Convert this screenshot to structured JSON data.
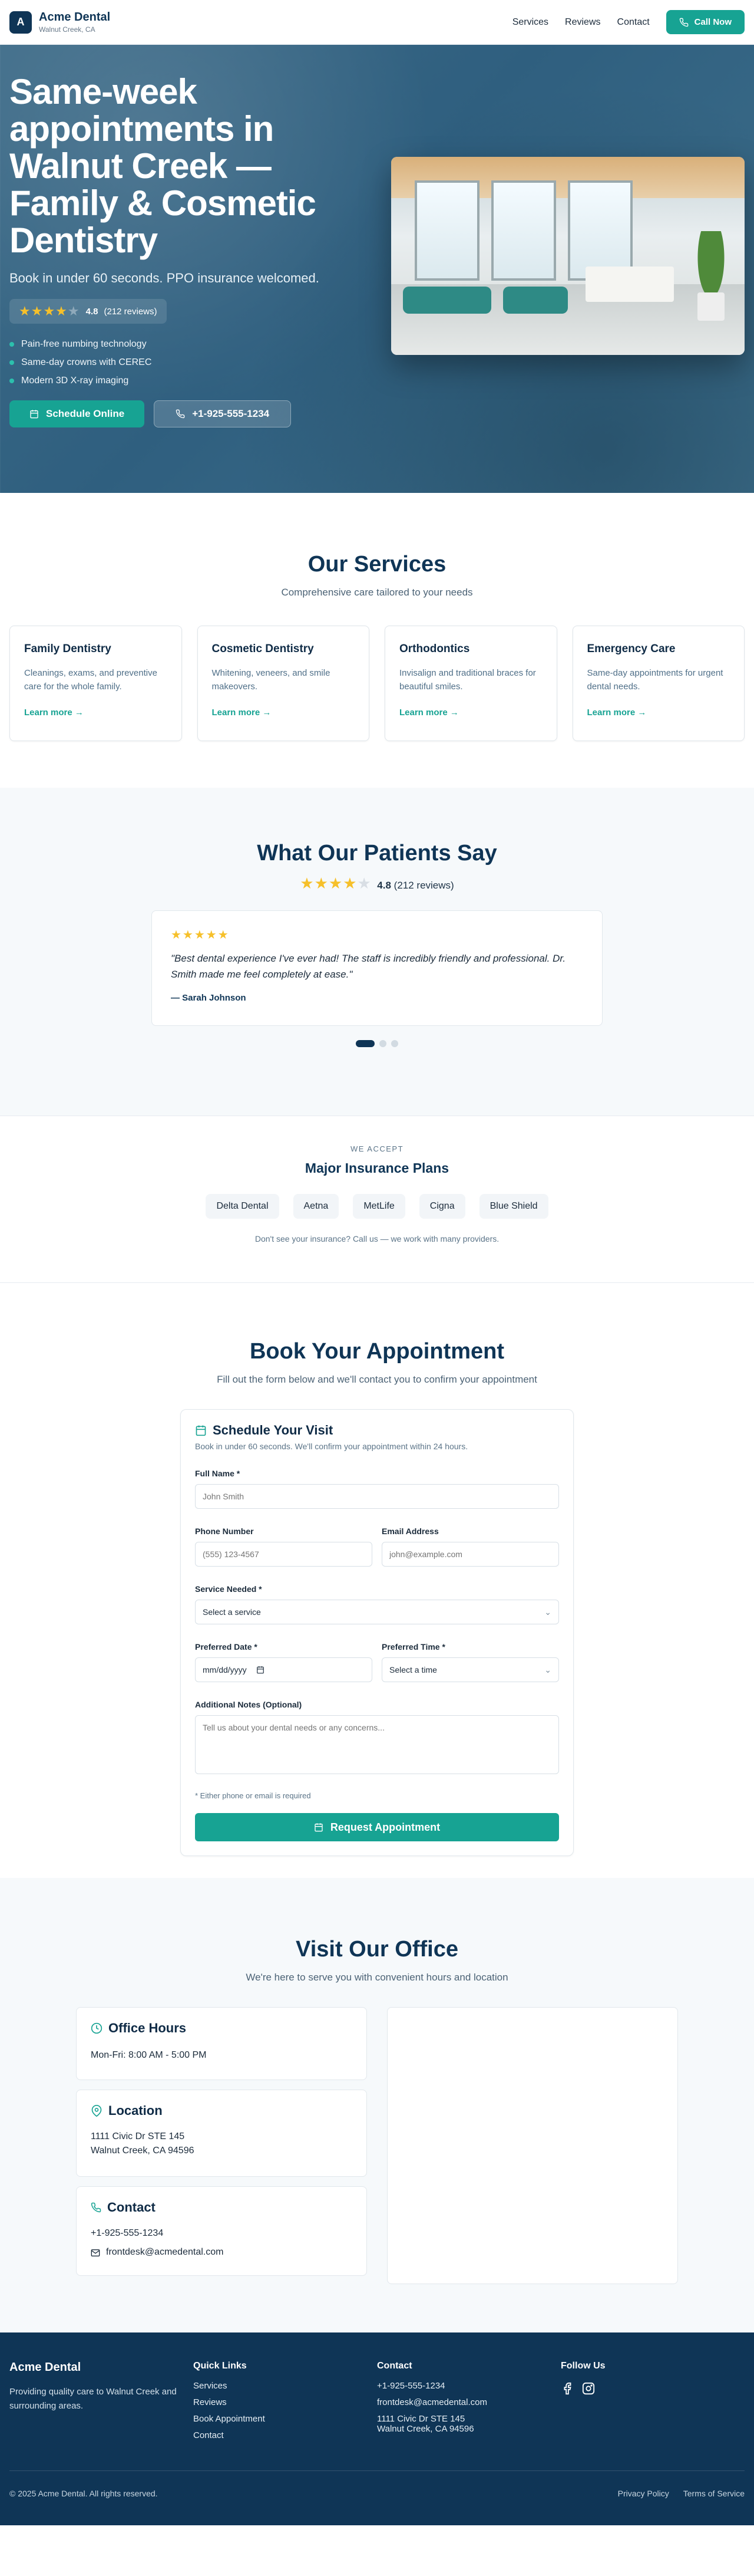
{
  "brand": {
    "logo_letter": "A",
    "name": "Acme Dental",
    "location": "Walnut Creek, CA"
  },
  "nav": {
    "links": [
      "Services",
      "Reviews",
      "Contact"
    ],
    "call_label": "Call Now"
  },
  "hero": {
    "title": "Same-week appointments in Walnut Creek — Family & Cosmetic Dentistry",
    "subtitle": "Book in under 60 seconds. PPO insurance welcomed.",
    "rating_value": "4.8",
    "rating_count": "(212 reviews)",
    "features": [
      "Pain-free numbing technology",
      "Same-day crowns with CEREC",
      "Modern 3D X-ray imaging"
    ],
    "primary_cta": "Schedule Online",
    "phone_cta": "+1-925-555-1234"
  },
  "services": {
    "title": "Our Services",
    "subtitle": "Comprehensive care tailored to your needs",
    "items": [
      {
        "title": "Family Dentistry",
        "desc": "Cleanings, exams, and preventive care for the whole family.",
        "link": "Learn more →"
      },
      {
        "title": "Cosmetic Dentistry",
        "desc": "Whitening, veneers, and smile makeovers.",
        "link": "Learn more →"
      },
      {
        "title": "Orthodontics",
        "desc": "Invisalign and traditional braces for beautiful smiles.",
        "link": "Learn more →"
      },
      {
        "title": "Emergency Care",
        "desc": "Same-day appointments for urgent dental needs.",
        "link": "Learn more →"
      }
    ]
  },
  "reviews": {
    "title": "What Our Patients Say",
    "rating_value": "4.8",
    "rating_count": "(212 reviews)",
    "quote": "\"Best dental experience I've ever had! The staff is incredibly friendly and professional. Dr. Smith made me feel completely at ease.\"",
    "author": "— Sarah Johnson",
    "active_slide": 1,
    "total_slides": 3
  },
  "insurance": {
    "eyebrow": "WE ACCEPT",
    "title": "Major Insurance Plans",
    "plans": [
      "Delta Dental",
      "Aetna",
      "MetLife",
      "Cigna",
      "Blue Shield"
    ],
    "note": "Don't see your insurance? Call us — we work with many providers."
  },
  "booking": {
    "title": "Book Your Appointment",
    "subtitle": "Fill out the form below and we'll contact you to confirm your appointment",
    "card_title": "Schedule Your Visit",
    "card_sub": "Book in under 60 seconds. We'll confirm your appointment within 24 hours.",
    "full_name_label": "Full Name *",
    "full_name_placeholder": "John Smith",
    "phone_label": "Phone Number",
    "phone_placeholder": "(555) 123-4567",
    "email_label": "Email Address",
    "email_placeholder": "john@example.com",
    "service_label": "Service Needed *",
    "service_value": "Select a service",
    "date_label": "Preferred Date *",
    "date_value": "mm/dd/yyyy",
    "time_label": "Preferred Time *",
    "time_value": "Select a time",
    "notes_label": "Additional Notes (Optional)",
    "notes_placeholder": "Tell us about your dental needs or any concerns...",
    "hint": "* Either phone or email is required",
    "submit_label": "Request Appointment"
  },
  "visit": {
    "title": "Visit Our Office",
    "subtitle": "We're here to serve you with convenient hours and location",
    "hours_title": "Office Hours",
    "hours": "Mon-Fri: 8:00 AM - 5:00 PM",
    "location_title": "Location",
    "address_line1": "1111 Civic Dr STE 145",
    "address_line2": "Walnut Creek, CA 94596",
    "contact_title": "Contact",
    "phone": "+1-925-555-1234",
    "email": "frontdesk@acmedental.com"
  },
  "footer": {
    "brand": "Acme Dental",
    "tagline": "Providing quality care to Walnut Creek and surrounding areas.",
    "quick_links_title": "Quick Links",
    "quick_links": [
      "Services",
      "Reviews",
      "Book Appointment",
      "Contact"
    ],
    "contact_title": "Contact",
    "phone": "+1-925-555-1234",
    "email": "frontdesk@acmedental.com",
    "address_line1": "1111 Civic Dr STE 145",
    "address_line2": "Walnut Creek, CA 94596",
    "follow_title": "Follow Us",
    "social_icons": [
      "facebook-icon",
      "instagram-icon"
    ],
    "copyright": "© 2025 Acme Dental. All rights reserved.",
    "legal_links": [
      "Privacy Policy",
      "Terms of Service"
    ]
  },
  "colors": {
    "primary": "#0f3556",
    "accent": "#17a393",
    "star": "#f6c02a"
  }
}
